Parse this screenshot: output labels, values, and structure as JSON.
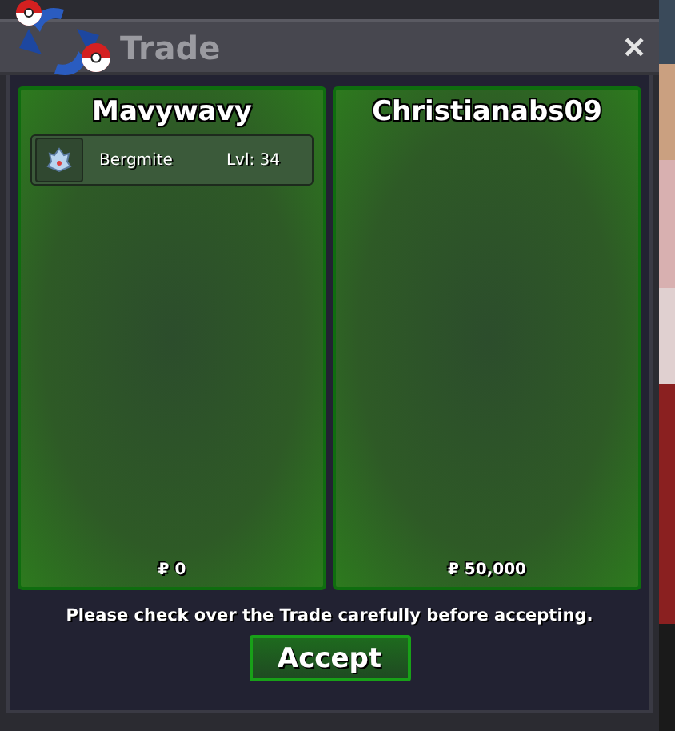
{
  "window": {
    "title": "Trade",
    "close": "✕"
  },
  "panels": [
    {
      "player": "Mavywavy",
      "items": [
        {
          "name": "Bergmite",
          "level": "Lvl: 34"
        }
      ],
      "money": "₽ 0"
    },
    {
      "player": "Christianabs09",
      "money": "₽ 50,000"
    }
  ],
  "notice": "Please check over the Trade carefully before accepting.",
  "accept": "Accept"
}
